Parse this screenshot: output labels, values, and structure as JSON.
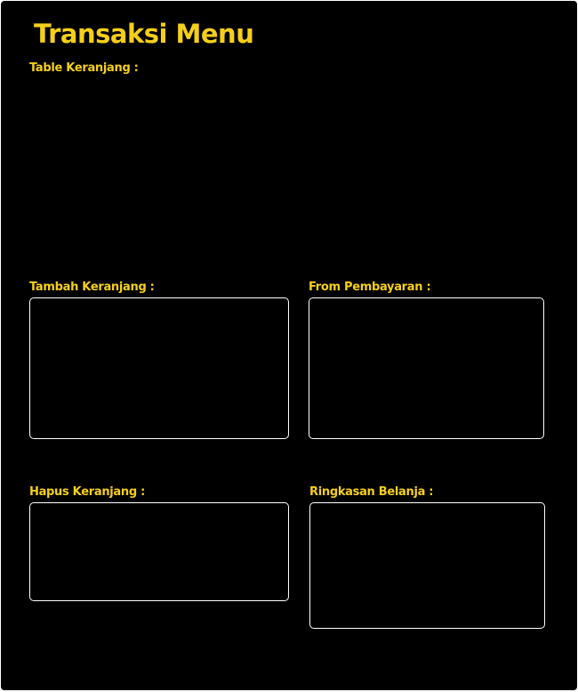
{
  "page": {
    "title": "Transaksi Menu"
  },
  "sections": {
    "table_keranjang": {
      "label": "Table Keranjang :"
    },
    "tambah_keranjang": {
      "label": "Tambah Keranjang :"
    },
    "form_pembayaran": {
      "label": "From Pembayaran :"
    },
    "hapus_keranjang": {
      "label": "Hapus Keranjang :"
    },
    "ringkasan_belanja": {
      "label": "Ringkasan Belanja :"
    }
  },
  "colors": {
    "background": "#000000",
    "accent": "#f5cf1a",
    "panel_border": "#ffffff"
  }
}
